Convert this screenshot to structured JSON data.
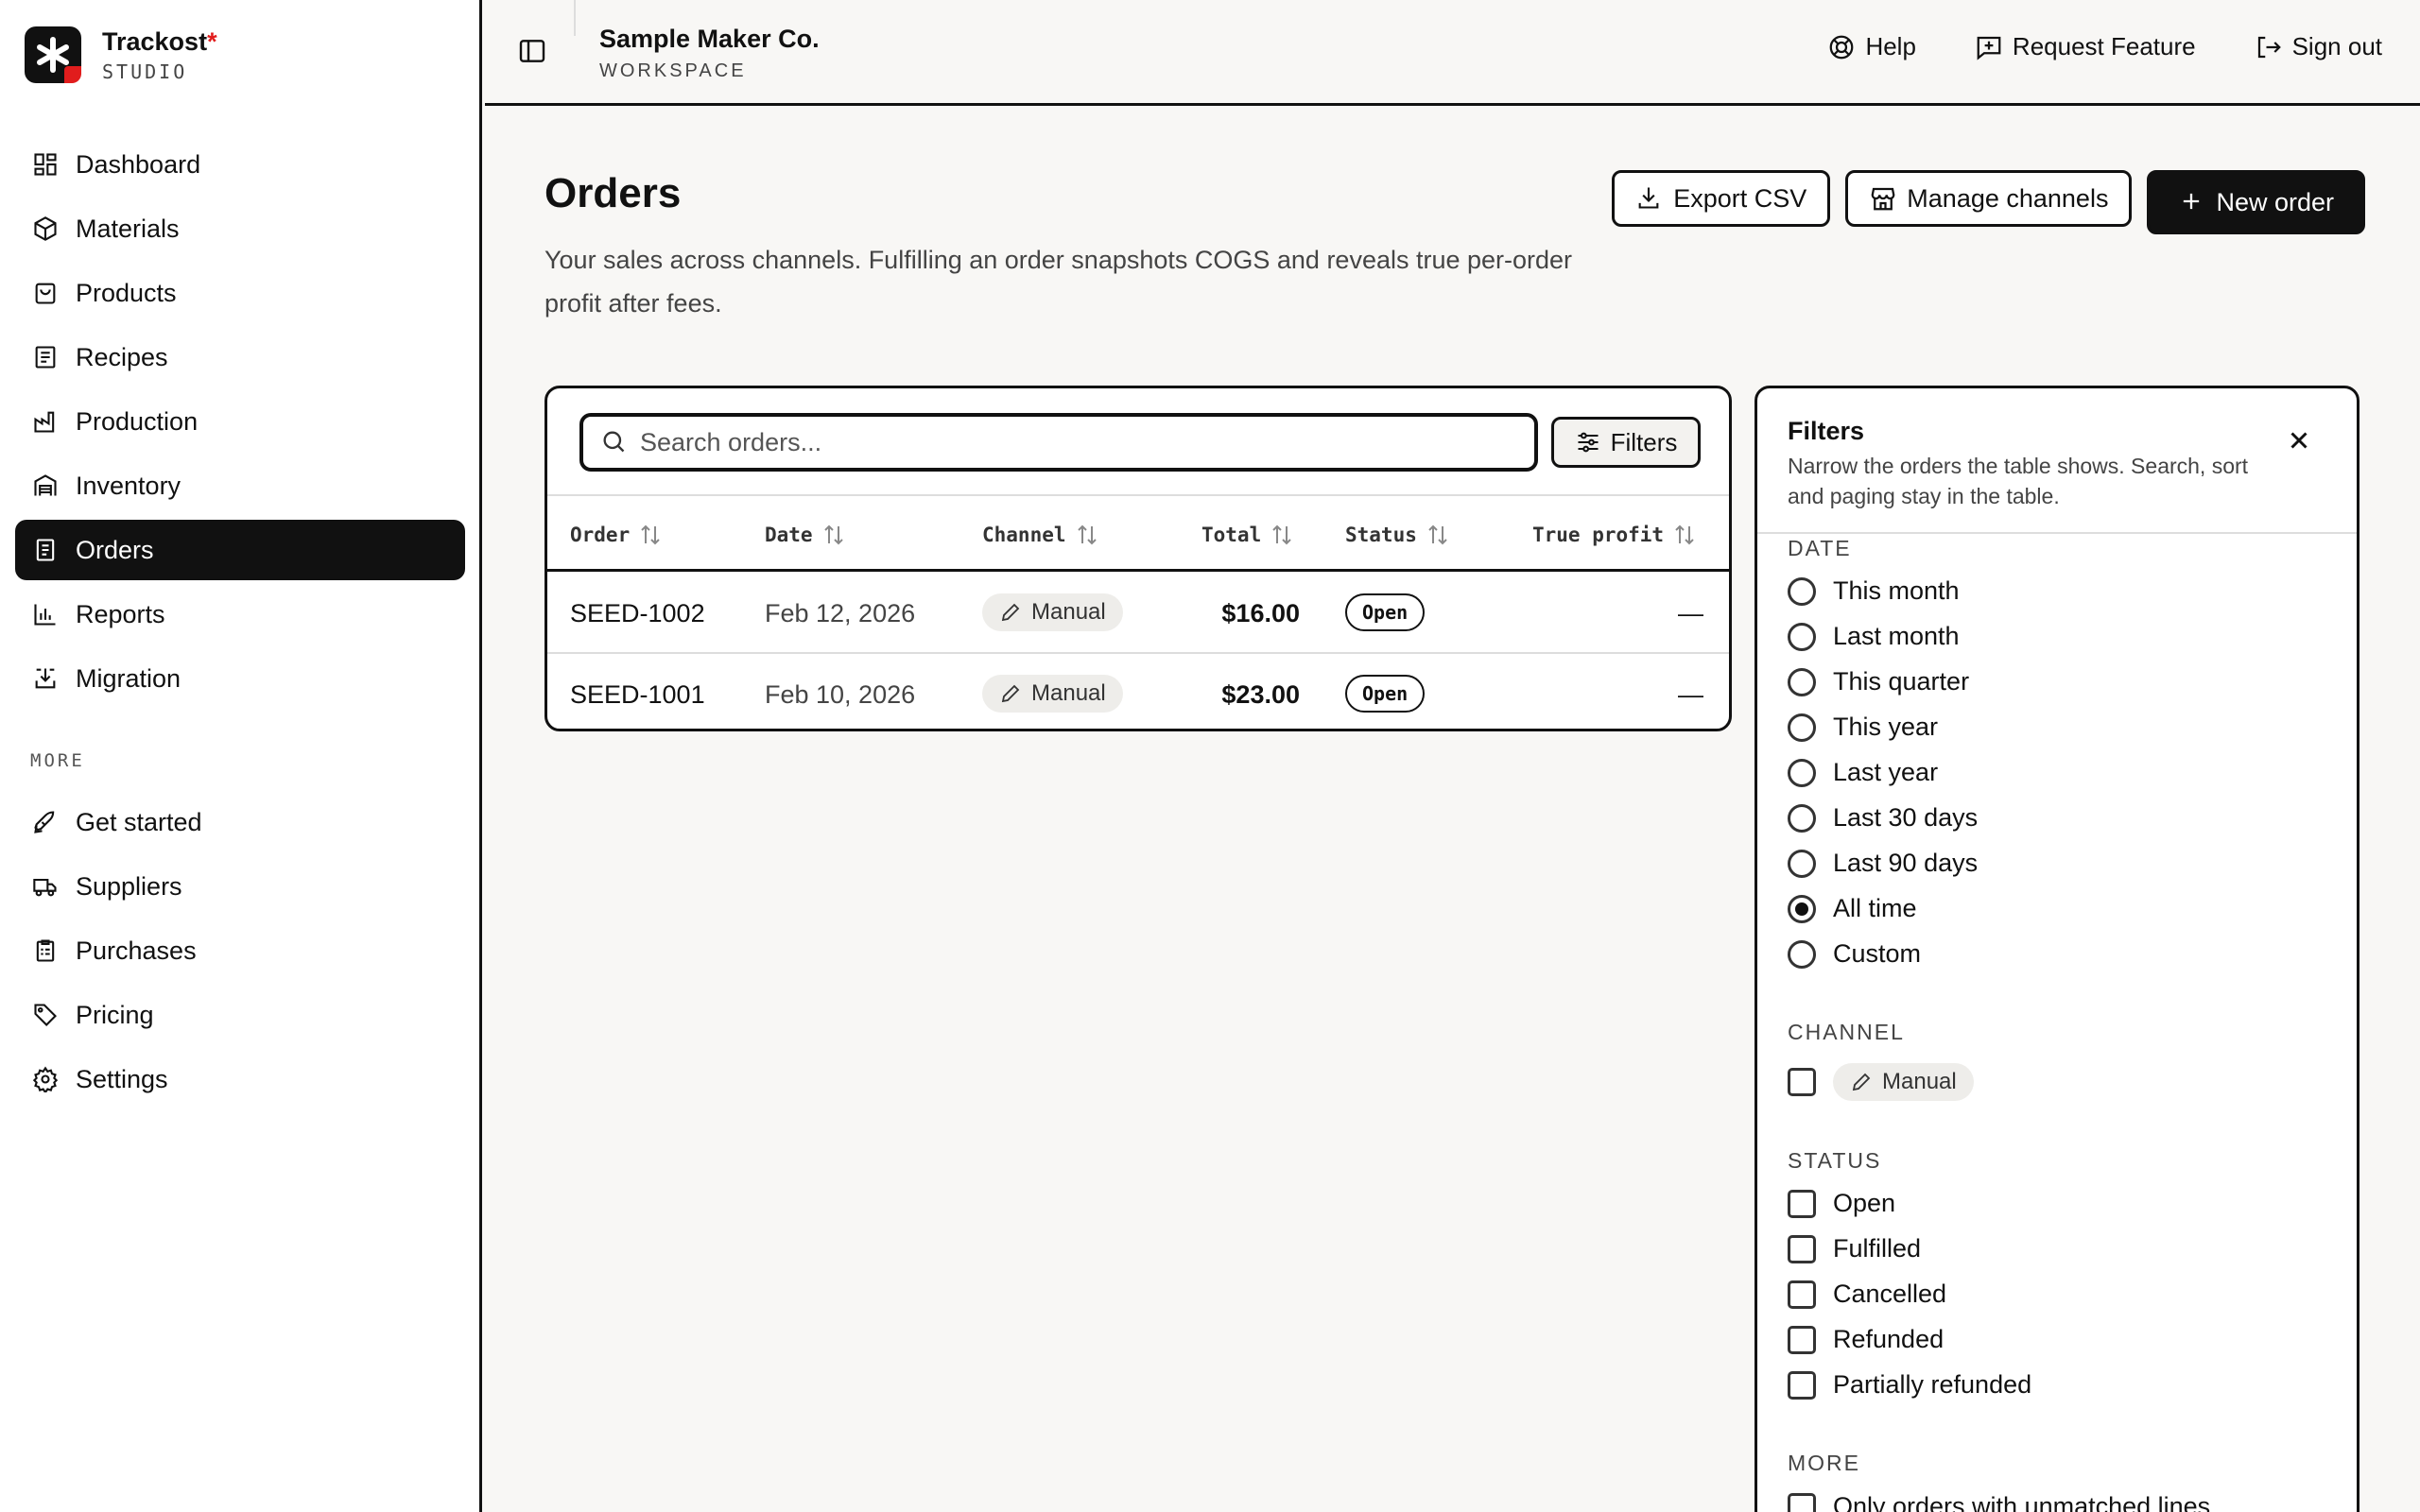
{
  "brand": {
    "name": "Trackost",
    "star": "*",
    "sub": "STUDIO"
  },
  "nav": {
    "items": [
      {
        "label": "Dashboard",
        "icon": "dashboard-icon"
      },
      {
        "label": "Materials",
        "icon": "box-icon"
      },
      {
        "label": "Products",
        "icon": "bag-icon"
      },
      {
        "label": "Recipes",
        "icon": "recipe-icon"
      },
      {
        "label": "Production",
        "icon": "factory-icon"
      },
      {
        "label": "Inventory",
        "icon": "warehouse-icon"
      },
      {
        "label": "Orders",
        "icon": "receipt-icon",
        "active": true
      },
      {
        "label": "Reports",
        "icon": "bar-chart-icon"
      },
      {
        "label": "Migration",
        "icon": "import-icon"
      }
    ],
    "more_label": "MORE",
    "more": [
      {
        "label": "Get started",
        "icon": "rocket-icon"
      },
      {
        "label": "Suppliers",
        "icon": "truck-icon"
      },
      {
        "label": "Purchases",
        "icon": "clipboard-icon"
      },
      {
        "label": "Pricing",
        "icon": "tag-icon"
      },
      {
        "label": "Settings",
        "icon": "gear-icon"
      }
    ]
  },
  "topbar": {
    "workspace_name": "Sample Maker Co.",
    "workspace_sub": "WORKSPACE",
    "help": "Help",
    "request": "Request Feature",
    "signout": "Sign out"
  },
  "page": {
    "title": "Orders",
    "description": "Your sales across channels. Fulfilling an order snapshots COGS and reveals true per-order profit after fees.",
    "export": "Export CSV",
    "manage": "Manage channels",
    "new_order": "New order"
  },
  "table": {
    "search_placeholder": "Search orders...",
    "filters_label": "Filters",
    "columns": [
      "Order",
      "Date",
      "Channel",
      "Total",
      "Status",
      "True profit"
    ],
    "rows": [
      {
        "order": "SEED-1002",
        "date": "Feb 12, 2026",
        "channel": "Manual",
        "total": "$16.00",
        "status": "Open",
        "profit": "—"
      },
      {
        "order": "SEED-1001",
        "date": "Feb 10, 2026",
        "channel": "Manual",
        "total": "$23.00",
        "status": "Open",
        "profit": "—"
      }
    ]
  },
  "filters": {
    "title": "Filters",
    "description": "Narrow the orders the table shows. Search, sort and paging stay in the table.",
    "date_title": "DATE",
    "date_options": [
      "This month",
      "Last month",
      "This quarter",
      "This year",
      "Last year",
      "Last 30 days",
      "Last 90 days",
      "All time",
      "Custom"
    ],
    "date_selected": "All time",
    "channel_title": "CHANNEL",
    "channel_options": [
      "Manual"
    ],
    "status_title": "STATUS",
    "status_options": [
      "Open",
      "Fulfilled",
      "Cancelled",
      "Refunded",
      "Partially refunded"
    ],
    "more_title": "MORE",
    "more_options": [
      "Only orders with unmatched lines"
    ]
  }
}
